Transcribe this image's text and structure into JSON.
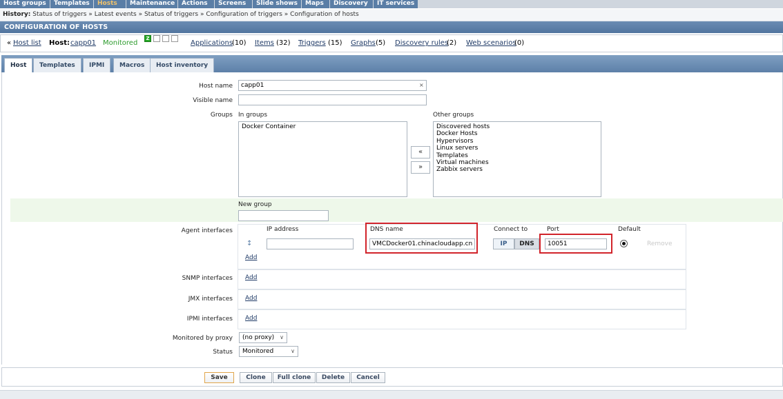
{
  "menu": [
    "Host groups",
    "Templates",
    "Hosts",
    "Maintenance",
    "Actions",
    "Screens",
    "Slide shows",
    "Maps",
    "Discovery",
    "IT services"
  ],
  "history": {
    "label": "History:",
    "items": [
      "Status of triggers",
      "Latest events",
      "Status of triggers",
      "Configuration of triggers",
      "Configuration of hosts"
    ],
    "separator": "»"
  },
  "title": "CONFIGURATION OF HOSTS",
  "hostnav": {
    "back": "«",
    "host_list": "Host list",
    "host_label": "Host:",
    "host_name": "capp01",
    "status": "Monitored",
    "availability": [
      "Z",
      "",
      "",
      ""
    ],
    "links": [
      {
        "label": "Applications",
        "count": "(10)"
      },
      {
        "label": "Items",
        "count": "(32)"
      },
      {
        "label": "Triggers",
        "count": "(15)"
      },
      {
        "label": "Graphs",
        "count": "(5)"
      },
      {
        "label": "Discovery rules",
        "count": "(2)"
      },
      {
        "label": "Web scenarios",
        "count": "(0)"
      }
    ]
  },
  "tabs": [
    "Host",
    "Templates",
    "IPMI",
    "Macros",
    "Host inventory"
  ],
  "form": {
    "host_name_label": "Host name",
    "host_name_value": "capp01",
    "clear_glyph": "×",
    "visible_name_label": "Visible name",
    "visible_name_value": "",
    "groups_label": "Groups",
    "in_groups_label": "In groups",
    "in_groups": [
      "Docker Container"
    ],
    "other_groups_label": "Other groups",
    "other_groups": [
      "Discovered hosts",
      "Docker Hosts",
      "Hypervisors",
      "Linux servers",
      "Templates",
      "Virtual machines",
      "Zabbix servers"
    ],
    "move_left": "«",
    "move_right": "»",
    "new_group_label": "New group",
    "new_group_value": "",
    "agent_label": "Agent interfaces",
    "col_ip": "IP address",
    "col_dns": "DNS name",
    "col_connect": "Connect to",
    "col_port": "Port",
    "col_default": "Default",
    "ip_value": "",
    "dns_value": "VMCDocker01.chinacloudapp.cn",
    "connect_ip": "IP",
    "connect_dns": "DNS",
    "port_value": "10051",
    "remove": "Remove",
    "drag_glyph": "↕",
    "add": "Add",
    "snmp_label": "SNMP interfaces",
    "jmx_label": "JMX interfaces",
    "ipmi_label": "IPMI interfaces",
    "proxy_label": "Monitored by proxy",
    "proxy_value": "(no proxy)",
    "status_label": "Status",
    "status_value": "Monitored",
    "select_arrow": "∨"
  },
  "buttons": {
    "save": "Save",
    "clone": "Clone",
    "full_clone": "Full clone",
    "delete": "Delete",
    "cancel": "Cancel"
  },
  "colors": {
    "accent_blue": "#5a7ea6",
    "active_menu": "#f1c36b",
    "monitored_green": "#2b9a2b",
    "highlight_red": "#d1232a"
  }
}
